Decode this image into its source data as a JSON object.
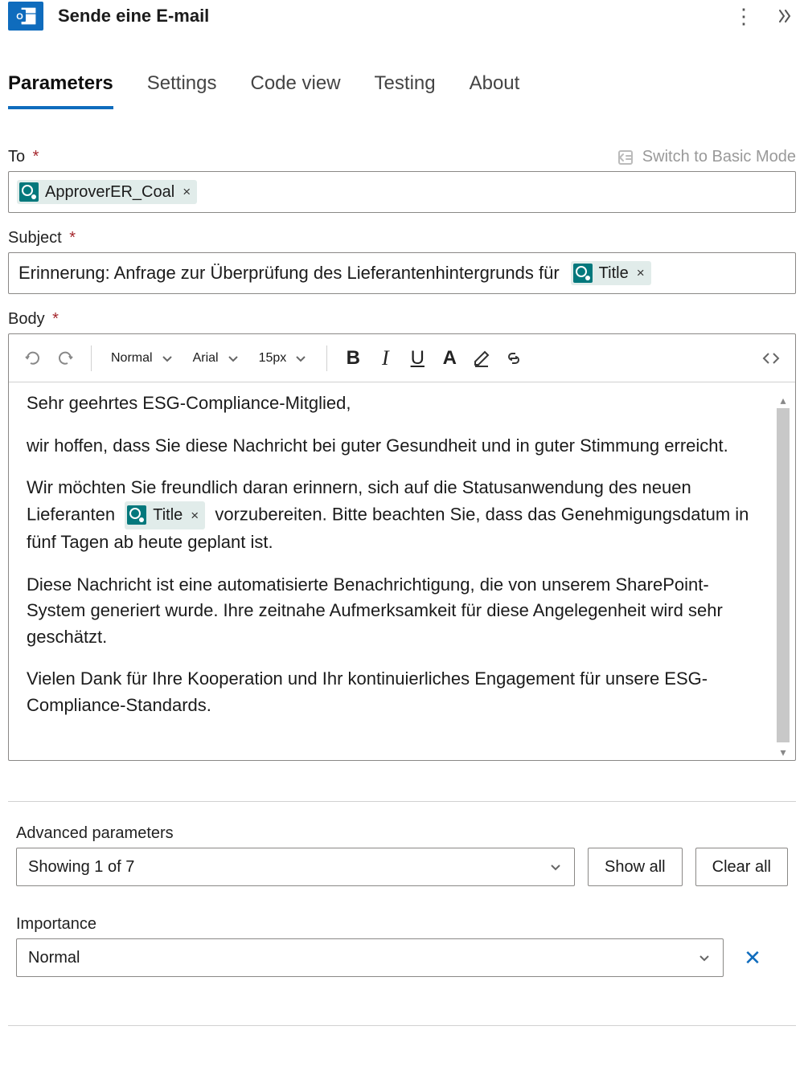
{
  "header": {
    "title": "Sende eine E-mail"
  },
  "tabs": [
    {
      "label": "Parameters",
      "active": true
    },
    {
      "label": "Settings",
      "active": false
    },
    {
      "label": "Code view",
      "active": false
    },
    {
      "label": "Testing",
      "active": false
    },
    {
      "label": "About",
      "active": false
    }
  ],
  "switchBasic": "Switch to Basic Mode",
  "fields": {
    "to": {
      "label": "To",
      "required": true,
      "pills": [
        {
          "text": "ApproverER_Coal"
        }
      ]
    },
    "subject": {
      "label": "Subject",
      "required": true,
      "prefixText": "Erinnerung: Anfrage zur Überprüfung des Lieferantenhintergrunds für",
      "pill": {
        "text": "Title"
      }
    },
    "body": {
      "label": "Body",
      "required": true,
      "toolbar": {
        "style": "Normal",
        "font": "Arial",
        "size": "15px"
      },
      "p1": "Sehr geehrtes ESG-Compliance-Mitglied,",
      "p2": "wir hoffen, dass Sie diese Nachricht bei guter Gesundheit und in guter Stimmung erreicht.",
      "p3a": "Wir möchten Sie freundlich daran erinnern, sich auf die Statusanwendung des neuen Lieferanten",
      "p3pill": "Title",
      "p3b": "vorzubereiten. Bitte beachten Sie, dass das Genehmigungsdatum in fünf Tagen ab heute geplant ist.",
      "p4": "Diese Nachricht ist eine automatisierte Benachrichtigung, die von unserem SharePoint-System generiert wurde. Ihre zeitnahe Aufmerksamkeit für diese Angelegenheit wird sehr geschätzt.",
      "p5": "Vielen Dank für Ihre Kooperation und Ihr kontinuierliches Engagement für unsere ESG-Compliance-Standards."
    }
  },
  "advanced": {
    "label": "Advanced parameters",
    "status": "Showing 1 of 7",
    "showAll": "Show all",
    "clearAll": "Clear all"
  },
  "importance": {
    "label": "Importance",
    "value": "Normal"
  }
}
